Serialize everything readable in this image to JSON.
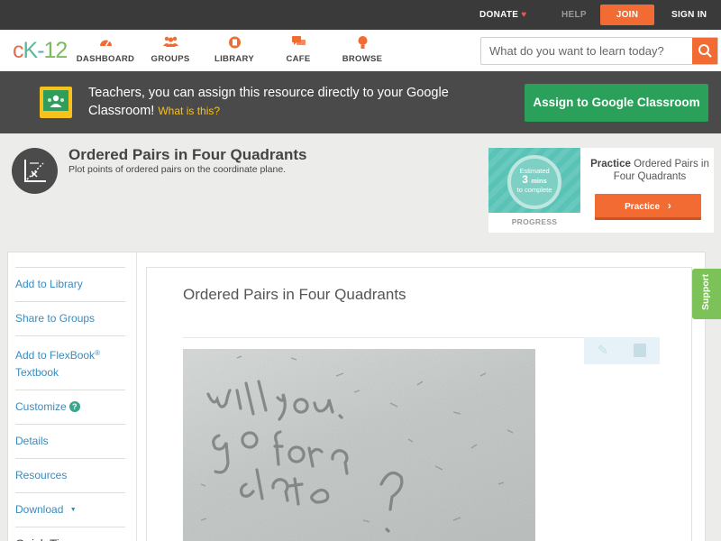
{
  "topbar": {
    "donate": "DONATE",
    "help": "HELP",
    "join": "JOIN",
    "signin": "SIGN IN"
  },
  "logo": {
    "c": "c",
    "k": "K",
    "dash": "-",
    "num": "12"
  },
  "nav": {
    "items": [
      {
        "label": "DASHBOARD",
        "icon": "dashboard-icon"
      },
      {
        "label": "GROUPS",
        "icon": "groups-icon"
      },
      {
        "label": "LIBRARY",
        "icon": "library-icon"
      },
      {
        "label": "CAFE",
        "icon": "cafe-icon"
      },
      {
        "label": "BROWSE",
        "icon": "browse-icon"
      }
    ],
    "search_placeholder": "What do you want to learn today?"
  },
  "banner": {
    "text": "Teachers, you can assign this resource directly to your Google Classroom!",
    "link": "What is this?",
    "button": "Assign to Google Classroom"
  },
  "concept": {
    "title": "Ordered Pairs in Four Quadrants",
    "subtitle": "Plot points of ordered pairs on the coordinate plane."
  },
  "practice_card": {
    "estimated": "Estimated",
    "mins_value": "3",
    "mins_unit": "mins",
    "to_complete": "to complete",
    "progress_label": "PROGRESS",
    "title_bold": "Practice",
    "title_rest": "Ordered Pairs in Four Quadrants",
    "button": "Practice"
  },
  "sidebar": {
    "items": [
      {
        "label": "Add to Library"
      },
      {
        "label": "Share to Groups"
      },
      {
        "label": "Add to FlexBook",
        "sup": "®",
        "line2": "Textbook"
      },
      {
        "label": "Customize"
      },
      {
        "label": "Details"
      },
      {
        "label": "Resources"
      },
      {
        "label": "Download"
      },
      {
        "label": "Quick Tips"
      }
    ],
    "customize_help": "?",
    "download_caret": "▼"
  },
  "main": {
    "title": "Ordered Pairs in Four Quadrants",
    "image_text": "will you go for a date?"
  },
  "support_tab": "Support",
  "colors": {
    "accent": "#f26b33",
    "topbar": "#3a3a3a",
    "banner": "#4a4a4a",
    "google_green": "#2aa05a",
    "link_blue": "#3a8bbd",
    "support_green": "#7cc259"
  }
}
